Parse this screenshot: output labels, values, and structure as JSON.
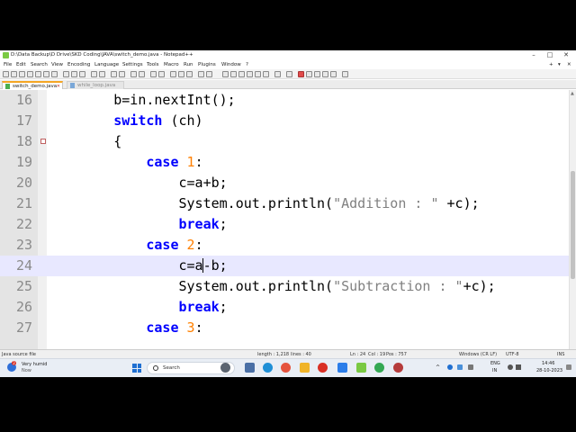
{
  "window": {
    "title": "D:\\Data Backup\\D Drive\\SKD Coding\\JAVA\\switch_demo.java - Notepad++",
    "minimize": "–",
    "maximize": "□",
    "close": "✕"
  },
  "menu": [
    "File",
    "Edit",
    "Search",
    "View",
    "Encoding",
    "Language",
    "Settings",
    "Tools",
    "Macro",
    "Run",
    "Plugins",
    "Window",
    "?"
  ],
  "menu_right": [
    "+",
    "▾",
    "✕"
  ],
  "tabs": [
    {
      "label": "switch_demo.java",
      "active": true
    },
    {
      "label": "while_loop.java",
      "active": false
    }
  ],
  "editor": {
    "lines": [
      {
        "num": "16",
        "tokens": [
          {
            "t": "        b=in.nextInt();",
            "c": ""
          }
        ]
      },
      {
        "num": "17",
        "tokens": [
          {
            "t": "        ",
            "c": ""
          },
          {
            "t": "switch",
            "c": "kw"
          },
          {
            "t": " (ch)",
            "c": ""
          }
        ]
      },
      {
        "num": "18",
        "tokens": [
          {
            "t": "        {",
            "c": ""
          }
        ]
      },
      {
        "num": "19",
        "tokens": [
          {
            "t": "            ",
            "c": ""
          },
          {
            "t": "case",
            "c": "kw"
          },
          {
            "t": " ",
            "c": ""
          },
          {
            "t": "1",
            "c": "num"
          },
          {
            "t": ":",
            "c": ""
          }
        ]
      },
      {
        "num": "20",
        "tokens": [
          {
            "t": "                c=a+b;",
            "c": ""
          }
        ]
      },
      {
        "num": "21",
        "tokens": [
          {
            "t": "                System.out.println(",
            "c": ""
          },
          {
            "t": "\"Addition : \"",
            "c": "str"
          },
          {
            "t": " +c);",
            "c": ""
          }
        ]
      },
      {
        "num": "22",
        "tokens": [
          {
            "t": "                ",
            "c": ""
          },
          {
            "t": "break",
            "c": "kw"
          },
          {
            "t": ";",
            "c": ""
          }
        ]
      },
      {
        "num": "23",
        "tokens": [
          {
            "t": "            ",
            "c": ""
          },
          {
            "t": "case",
            "c": "kw"
          },
          {
            "t": " ",
            "c": ""
          },
          {
            "t": "2",
            "c": "num"
          },
          {
            "t": ":",
            "c": ""
          }
        ]
      },
      {
        "num": "24",
        "tokens": [
          {
            "t": "                c=a",
            "c": ""
          },
          {
            "t": "-",
            "c": ""
          },
          {
            "t": "b;",
            "c": ""
          }
        ]
      },
      {
        "num": "25",
        "tokens": [
          {
            "t": "                System.out.println(",
            "c": ""
          },
          {
            "t": "\"Subtraction : \"",
            "c": "str"
          },
          {
            "t": "+c);",
            "c": ""
          }
        ]
      },
      {
        "num": "26",
        "tokens": [
          {
            "t": "                ",
            "c": ""
          },
          {
            "t": "break",
            "c": "kw"
          },
          {
            "t": ";",
            "c": ""
          }
        ]
      },
      {
        "num": "27",
        "tokens": [
          {
            "t": "            ",
            "c": ""
          },
          {
            "t": "case",
            "c": "kw"
          },
          {
            "t": " ",
            "c": ""
          },
          {
            "t": "3",
            "c": "num"
          },
          {
            "t": ":",
            "c": ""
          }
        ]
      }
    ],
    "current_line": "24"
  },
  "status": {
    "file_type": "Java source file",
    "length": "length : 1,218",
    "lines": "lines : 40",
    "ln": "Ln : 24",
    "col": "Col : 19",
    "pos": "Pos : 757",
    "eol": "Windows (CR LF)",
    "encoding": "UTF-8",
    "mode": "INS"
  },
  "taskbar": {
    "weather_badge": "2",
    "weather": "Very humid",
    "weather_sub": "Now",
    "search_placeholder": "Search",
    "lang_top": "ENG",
    "lang_bottom": "IN",
    "time": "14:46",
    "date": "28-10-2023"
  },
  "colors": {
    "keyword": "#0000ff",
    "number": "#ff8000",
    "string": "#808080",
    "current_line_bg": "#e8e8ff"
  }
}
